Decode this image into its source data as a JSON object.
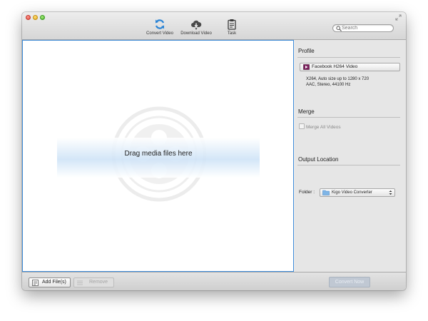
{
  "toolbar": {
    "convert_label": "Convert Video",
    "download_label": "Download Video",
    "task_label": "Task"
  },
  "search": {
    "placeholder": "Search"
  },
  "dropzone": {
    "text": "Drag media files here"
  },
  "profile": {
    "title": "Profile",
    "button_label": "Facebook H264 Video",
    "desc_line1": "X264, Auto size up to 1280 x 720",
    "desc_line2": "AAC, Stereo, 44100 Hz"
  },
  "merge": {
    "title": "Merge",
    "checkbox_label": "Merge All Videos",
    "checked": false
  },
  "output": {
    "title": "Output Location",
    "folder_label": "Folder :",
    "folder_value": "Kigo Video Converter"
  },
  "bottom": {
    "add_label": "Add File(s)",
    "remove_label": "Remove",
    "convert_now_label": "Convert Now"
  },
  "colors": {
    "accent_blue": "#3c8bd9",
    "convert_disabled": "#c0c8d3"
  }
}
